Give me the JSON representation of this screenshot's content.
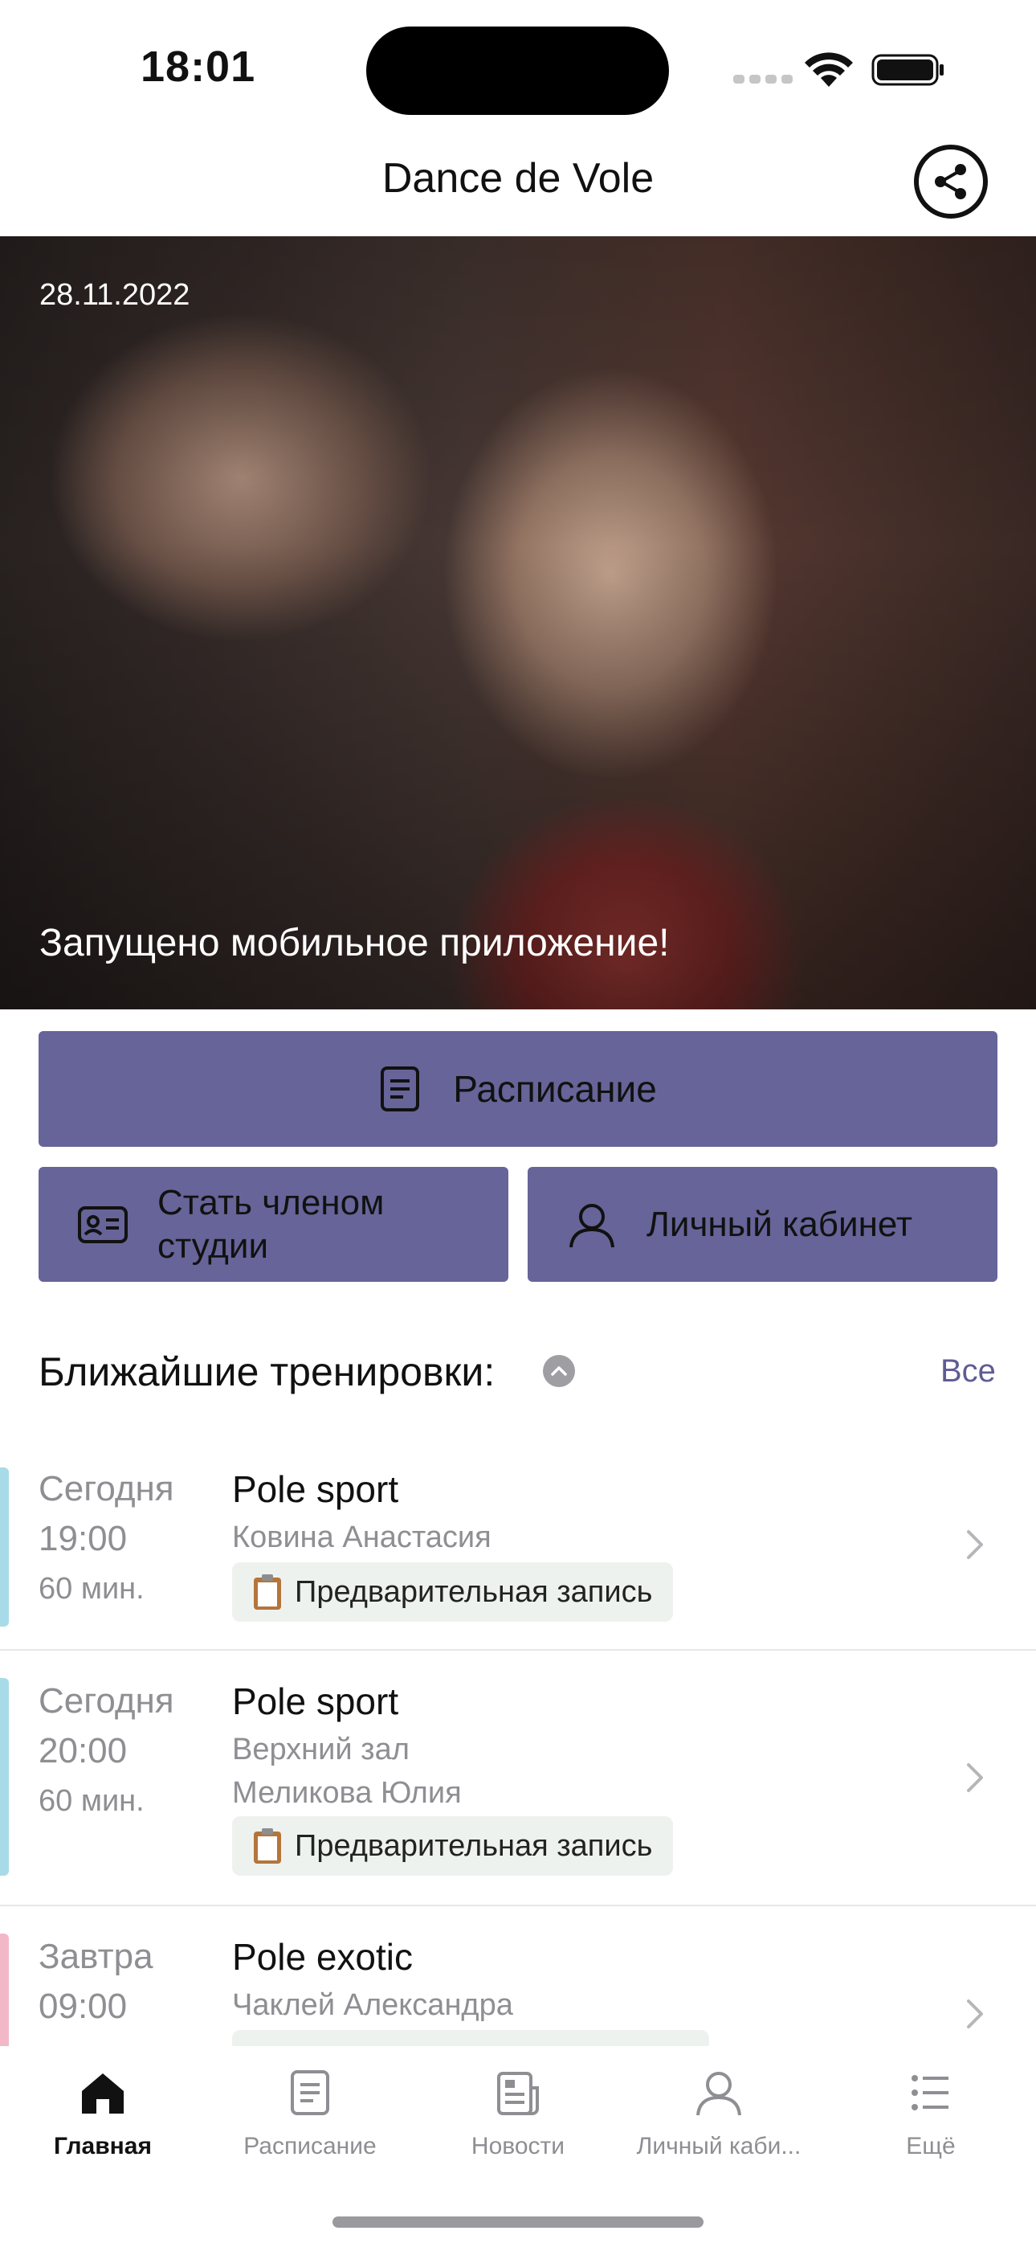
{
  "status": {
    "time": "18:01"
  },
  "header": {
    "title": "Dance de Vole"
  },
  "hero": {
    "date": "28.11.2022",
    "caption": "Запущено мобильное приложение!"
  },
  "actions": {
    "schedule": "Расписание",
    "member_line1": "Стать членом",
    "member_line2": "студии",
    "cabinet": "Личный кабинет"
  },
  "colors": {
    "accent": "#666498",
    "link": "#5f5c94",
    "stripe_blue": "#a8dbe8",
    "stripe_pink": "#f2b8c8"
  },
  "upcoming": {
    "title": "Ближайшие тренировки:",
    "all": "Все",
    "items": [
      {
        "day": "Сегодня",
        "time": "19:00",
        "duration": "60 мин.",
        "name": "Pole sport",
        "room": "",
        "trainer": "Ковина Анастасия",
        "tag": "Предварительная запись",
        "stripe": "blue"
      },
      {
        "day": "Сегодня",
        "time": "20:00",
        "duration": "60 мин.",
        "name": "Pole sport",
        "room": "Верхний зал",
        "trainer": "Меликова Юлия",
        "tag": "Предварительная запись",
        "stripe": "blue"
      },
      {
        "day": "Завтра",
        "time": "09:00",
        "duration": "",
        "name": "Pole exotic",
        "room": "",
        "trainer": "Чаклей Александра",
        "tag": "",
        "stripe": "pink"
      }
    ]
  },
  "tabbar": {
    "home": "Главная",
    "schedule": "Расписание",
    "news": "Новости",
    "cabinet": "Личный каби...",
    "more": "Ещё"
  }
}
